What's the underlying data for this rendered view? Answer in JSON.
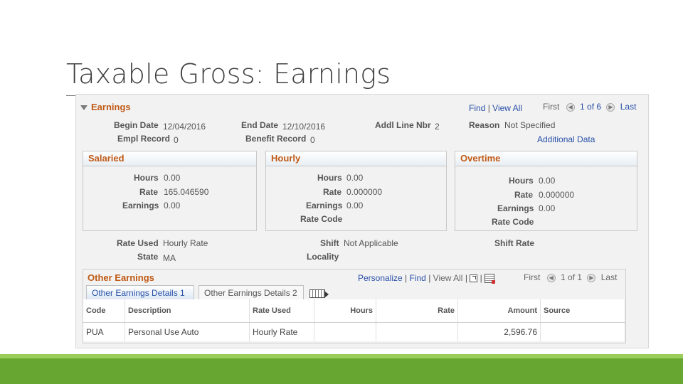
{
  "slide": {
    "title": "Taxable Gross: Earnings"
  },
  "earnings": {
    "header": "Earnings",
    "nav": {
      "find": "Find",
      "view_all": "View All",
      "first": "First",
      "counter": "1 of 6",
      "last": "Last"
    },
    "begin_date_label": "Begin Date",
    "begin_date": "12/04/2016",
    "end_date_label": "End Date",
    "end_date": "12/10/2016",
    "addl_line_label": "Addl Line Nbr",
    "addl_line": "2",
    "reason_label": "Reason",
    "reason": "Not Specified",
    "empl_record_label": "Empl Record",
    "empl_record": "0",
    "benefit_record_label": "Benefit Record",
    "benefit_record": "0",
    "additional_data": "Additional Data"
  },
  "salaried": {
    "header": "Salaried",
    "hours_label": "Hours",
    "hours": "0.00",
    "rate_label": "Rate",
    "rate": "165.046590",
    "earnings_label": "Earnings",
    "earnings": "0.00"
  },
  "hourly": {
    "header": "Hourly",
    "hours_label": "Hours",
    "hours": "0.00",
    "rate_label": "Rate",
    "rate": "0.000000",
    "earnings_label": "Earnings",
    "earnings": "0.00",
    "rate_code_label": "Rate Code"
  },
  "overtime": {
    "header": "Overtime",
    "hours_label": "Hours",
    "hours": "0.00",
    "rate_label": "Rate",
    "rate": "0.000000",
    "earnings_label": "Earnings",
    "earnings": "0.00",
    "rate_code_label": "Rate Code"
  },
  "misc": {
    "rate_used_label": "Rate Used",
    "rate_used": "Hourly Rate",
    "shift_label": "Shift",
    "shift": "Not Applicable",
    "shift_rate_label": "Shift Rate",
    "state_label": "State",
    "state": "MA",
    "locality_label": "Locality"
  },
  "other_earnings": {
    "header": "Other Earnings",
    "nav": {
      "personalize": "Personalize",
      "find": "Find",
      "view_all": "View All",
      "first": "First",
      "counter": "1 of 1",
      "last": "Last"
    },
    "tabs": [
      {
        "label": "Other Earnings Details 1",
        "active": true
      },
      {
        "label": "Other Earnings Details 2",
        "active": false
      }
    ],
    "columns": [
      "Code",
      "Description",
      "Rate Used",
      "Hours",
      "Rate",
      "Amount",
      "Source"
    ],
    "rows": [
      [
        "PUA",
        "Personal Use Auto",
        "Hourly Rate",
        "",
        "",
        "2,596.76",
        ""
      ]
    ]
  },
  "colors": {
    "section_header": "#c05a16",
    "link": "#2950a8",
    "footer_light": "#9acd5a",
    "footer_dark": "#66a631"
  }
}
